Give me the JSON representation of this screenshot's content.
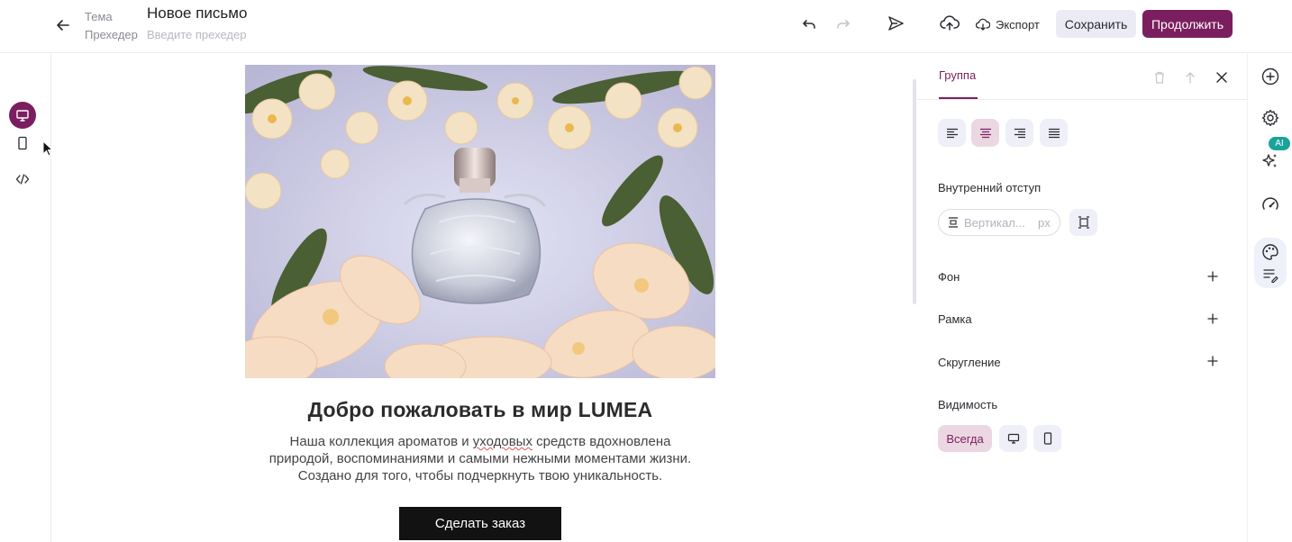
{
  "header": {
    "theme_label": "Тема",
    "preheader_label": "Прехедер",
    "title": "Новое письмо",
    "preheader_placeholder": "Введите прехедер",
    "export_label": "Экспорт",
    "save_label": "Сохранить",
    "continue_label": "Продолжить"
  },
  "email": {
    "heading": "Добро пожаловать в мир LUMEA",
    "body_line1_pre": "Наша коллекция ароматов и ",
    "body_line1_spell": "уходовых",
    "body_line1_post": " средств вдохновлена",
    "body_line2": "природой, воспоминаниями и самыми нежными моментами жизни.",
    "body_line3": "Создано для того, чтобы подчеркнуть твою уникальность.",
    "cta_label": "Сделать заказ"
  },
  "panel": {
    "tab": "Группа",
    "padding_label": "Внутренний отступ",
    "padding_placeholder": "Вертикал...",
    "padding_unit": "px",
    "background_label": "Фон",
    "border_label": "Рамка",
    "radius_label": "Скругление",
    "visibility_label": "Видимость",
    "visibility_always": "Всегда"
  },
  "right_rail": {
    "ai_badge": "AI"
  },
  "colors": {
    "accent": "#7b1e5f",
    "accent_soft": "#ebd7e2",
    "neutral_soft": "#eeeff8",
    "ai_badge": "#1aa39a"
  }
}
